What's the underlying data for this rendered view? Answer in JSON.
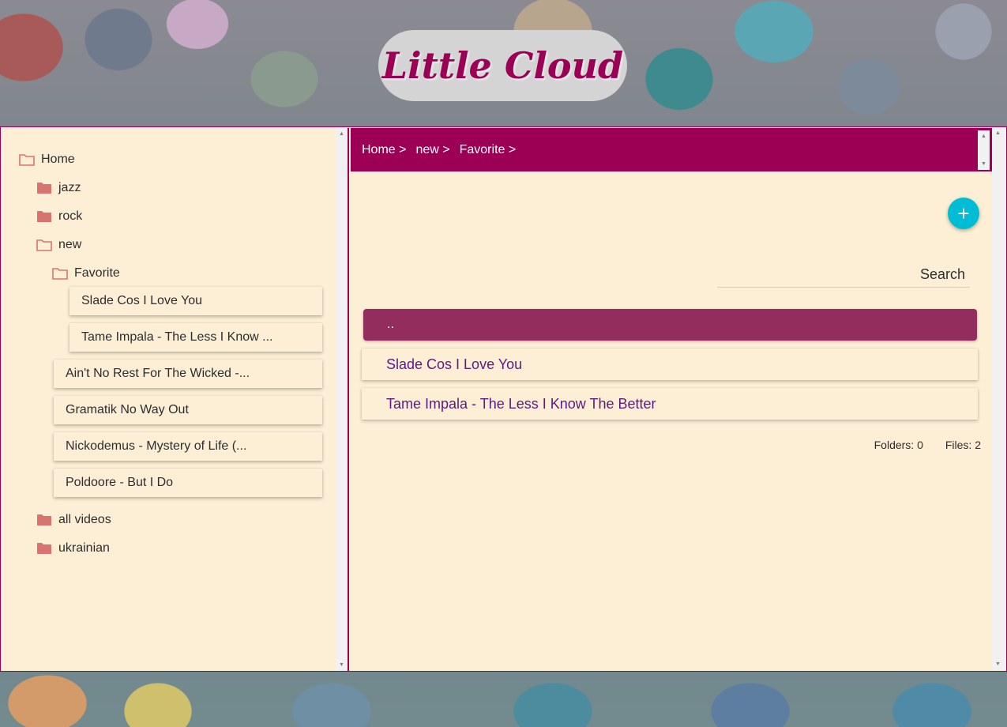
{
  "app": {
    "title": "Little Cloud"
  },
  "tree": {
    "root": {
      "label": "Home"
    },
    "folders": [
      {
        "label": "jazz"
      },
      {
        "label": "rock"
      },
      {
        "label": "new"
      }
    ],
    "subfolder": {
      "label": "Favorite"
    },
    "favorite_files": [
      {
        "label": "Slade Cos I Love You"
      },
      {
        "label": "Tame Impala - The Less I Know ..."
      }
    ],
    "new_files": [
      {
        "label": "Ain't No Rest For The Wicked -..."
      },
      {
        "label": "Gramatik No Way Out"
      },
      {
        "label": "Nickodemus - Mystery of Life (..."
      },
      {
        "label": "Poldoore - But I Do"
      }
    ],
    "more_folders": [
      {
        "label": "all videos"
      },
      {
        "label": "ukrainian"
      }
    ]
  },
  "breadcrumb": [
    "Home >",
    "new >",
    "Favorite >"
  ],
  "search": {
    "label": "Search",
    "value": ""
  },
  "fab": {
    "symbol": "+"
  },
  "listing": {
    "parent_label": "..",
    "files": [
      {
        "label": "Slade Cos I Love You"
      },
      {
        "label": "Tame Impala - The Less I Know The Better"
      }
    ]
  },
  "counts": {
    "folders": "Folders: 0",
    "files": "Files: 2"
  },
  "colors": {
    "accent": "#9c0055",
    "panel_bg": "#fdefd6",
    "folder_icon": "#d9736f",
    "fab": "#00bcd4",
    "parent_row": "#922d5e",
    "file_link": "#5a1a82"
  }
}
